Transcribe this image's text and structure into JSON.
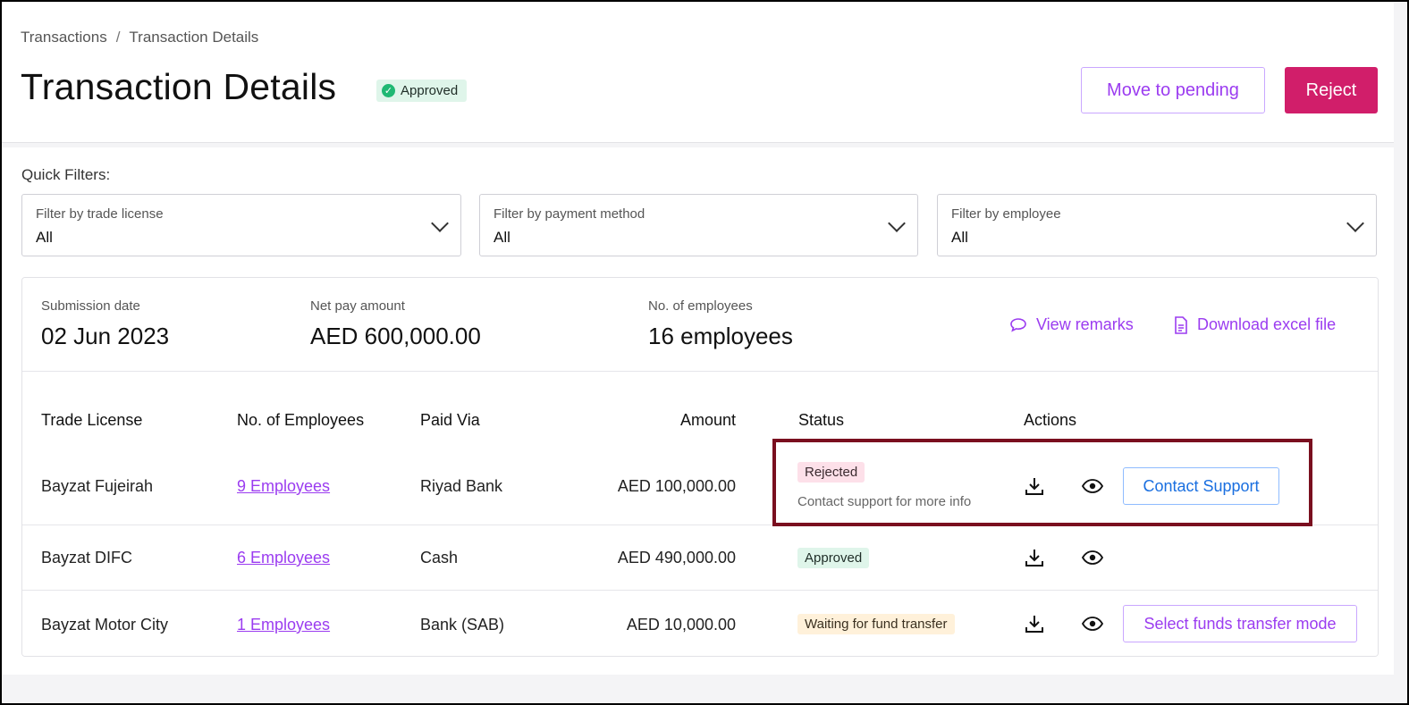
{
  "breadcrumb": {
    "parent": "Transactions",
    "separator": "/",
    "current": "Transaction Details"
  },
  "page": {
    "title": "Transaction Details",
    "status_badge": "Approved"
  },
  "header_actions": {
    "move_to_pending": "Move to pending",
    "reject": "Reject"
  },
  "filters": {
    "label": "Quick Filters:",
    "items": [
      {
        "label": "Filter by trade license",
        "value": "All"
      },
      {
        "label": "Filter by payment method",
        "value": "All"
      },
      {
        "label": "Filter by employee",
        "value": "All"
      }
    ]
  },
  "summary": {
    "submission_date": {
      "label": "Submission date",
      "value": "02 Jun 2023"
    },
    "net_pay": {
      "label": "Net pay amount",
      "value": "AED 600,000.00"
    },
    "employees": {
      "label": "No. of employees",
      "value": "16 employees"
    },
    "view_remarks": "View remarks",
    "download_excel": "Download excel file"
  },
  "table": {
    "columns": [
      "Trade License",
      "No. of Employees",
      "Paid Via",
      "Amount",
      "Status",
      "Actions"
    ],
    "rows": [
      {
        "trade_license": "Bayzat Fujeirah",
        "employees": "9 Employees",
        "paid_via": "Riyad Bank",
        "amount": "AED 100,000.00",
        "status": "Rejected",
        "status_note": "Contact support for more info",
        "action": "Contact Support"
      },
      {
        "trade_license": "Bayzat DIFC",
        "employees": "6 Employees",
        "paid_via": "Cash",
        "amount": "AED 490,000.00",
        "status": "Approved",
        "status_note": "",
        "action": ""
      },
      {
        "trade_license": "Bayzat Motor City",
        "employees": "1 Employees",
        "paid_via": "Bank (SAB)",
        "amount": "AED 10,000.00",
        "status": "Waiting for fund transfer",
        "status_note": "",
        "action": "Select funds transfer mode"
      }
    ]
  },
  "colors": {
    "accent_purple": "#9b3cf0",
    "reject_pink": "#d11e6a",
    "highlight_border": "#7a0f1f",
    "approved_green": "#1fb873"
  },
  "icons": [
    "check-circle-icon",
    "chevron-down-icon",
    "comment-icon",
    "document-icon",
    "download-icon",
    "eye-icon"
  ]
}
